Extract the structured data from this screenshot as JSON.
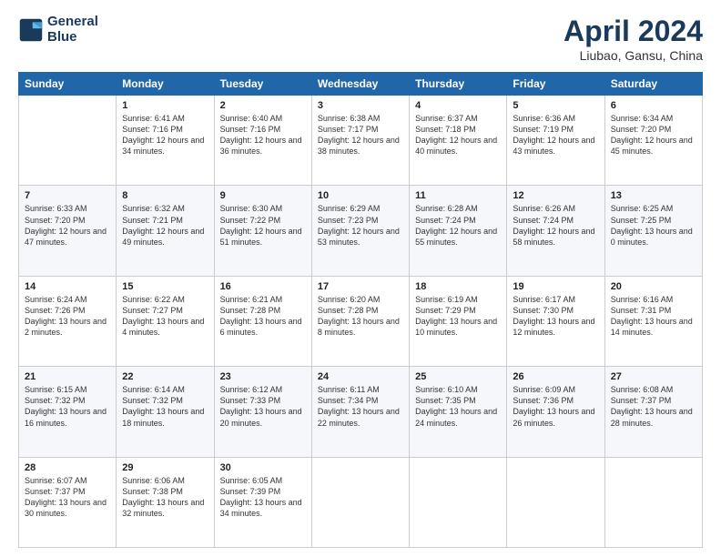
{
  "header": {
    "logo_line1": "General",
    "logo_line2": "Blue",
    "title": "April 2024",
    "subtitle": "Liubao, Gansu, China"
  },
  "weekdays": [
    "Sunday",
    "Monday",
    "Tuesday",
    "Wednesday",
    "Thursday",
    "Friday",
    "Saturday"
  ],
  "weeks": [
    [
      {
        "day": "",
        "sunrise": "",
        "sunset": "",
        "daylight": ""
      },
      {
        "day": "1",
        "sunrise": "Sunrise: 6:41 AM",
        "sunset": "Sunset: 7:16 PM",
        "daylight": "Daylight: 12 hours and 34 minutes."
      },
      {
        "day": "2",
        "sunrise": "Sunrise: 6:40 AM",
        "sunset": "Sunset: 7:16 PM",
        "daylight": "Daylight: 12 hours and 36 minutes."
      },
      {
        "day": "3",
        "sunrise": "Sunrise: 6:38 AM",
        "sunset": "Sunset: 7:17 PM",
        "daylight": "Daylight: 12 hours and 38 minutes."
      },
      {
        "day": "4",
        "sunrise": "Sunrise: 6:37 AM",
        "sunset": "Sunset: 7:18 PM",
        "daylight": "Daylight: 12 hours and 40 minutes."
      },
      {
        "day": "5",
        "sunrise": "Sunrise: 6:36 AM",
        "sunset": "Sunset: 7:19 PM",
        "daylight": "Daylight: 12 hours and 43 minutes."
      },
      {
        "day": "6",
        "sunrise": "Sunrise: 6:34 AM",
        "sunset": "Sunset: 7:20 PM",
        "daylight": "Daylight: 12 hours and 45 minutes."
      }
    ],
    [
      {
        "day": "7",
        "sunrise": "Sunrise: 6:33 AM",
        "sunset": "Sunset: 7:20 PM",
        "daylight": "Daylight: 12 hours and 47 minutes."
      },
      {
        "day": "8",
        "sunrise": "Sunrise: 6:32 AM",
        "sunset": "Sunset: 7:21 PM",
        "daylight": "Daylight: 12 hours and 49 minutes."
      },
      {
        "day": "9",
        "sunrise": "Sunrise: 6:30 AM",
        "sunset": "Sunset: 7:22 PM",
        "daylight": "Daylight: 12 hours and 51 minutes."
      },
      {
        "day": "10",
        "sunrise": "Sunrise: 6:29 AM",
        "sunset": "Sunset: 7:23 PM",
        "daylight": "Daylight: 12 hours and 53 minutes."
      },
      {
        "day": "11",
        "sunrise": "Sunrise: 6:28 AM",
        "sunset": "Sunset: 7:24 PM",
        "daylight": "Daylight: 12 hours and 55 minutes."
      },
      {
        "day": "12",
        "sunrise": "Sunrise: 6:26 AM",
        "sunset": "Sunset: 7:24 PM",
        "daylight": "Daylight: 12 hours and 58 minutes."
      },
      {
        "day": "13",
        "sunrise": "Sunrise: 6:25 AM",
        "sunset": "Sunset: 7:25 PM",
        "daylight": "Daylight: 13 hours and 0 minutes."
      }
    ],
    [
      {
        "day": "14",
        "sunrise": "Sunrise: 6:24 AM",
        "sunset": "Sunset: 7:26 PM",
        "daylight": "Daylight: 13 hours and 2 minutes."
      },
      {
        "day": "15",
        "sunrise": "Sunrise: 6:22 AM",
        "sunset": "Sunset: 7:27 PM",
        "daylight": "Daylight: 13 hours and 4 minutes."
      },
      {
        "day": "16",
        "sunrise": "Sunrise: 6:21 AM",
        "sunset": "Sunset: 7:28 PM",
        "daylight": "Daylight: 13 hours and 6 minutes."
      },
      {
        "day": "17",
        "sunrise": "Sunrise: 6:20 AM",
        "sunset": "Sunset: 7:28 PM",
        "daylight": "Daylight: 13 hours and 8 minutes."
      },
      {
        "day": "18",
        "sunrise": "Sunrise: 6:19 AM",
        "sunset": "Sunset: 7:29 PM",
        "daylight": "Daylight: 13 hours and 10 minutes."
      },
      {
        "day": "19",
        "sunrise": "Sunrise: 6:17 AM",
        "sunset": "Sunset: 7:30 PM",
        "daylight": "Daylight: 13 hours and 12 minutes."
      },
      {
        "day": "20",
        "sunrise": "Sunrise: 6:16 AM",
        "sunset": "Sunset: 7:31 PM",
        "daylight": "Daylight: 13 hours and 14 minutes."
      }
    ],
    [
      {
        "day": "21",
        "sunrise": "Sunrise: 6:15 AM",
        "sunset": "Sunset: 7:32 PM",
        "daylight": "Daylight: 13 hours and 16 minutes."
      },
      {
        "day": "22",
        "sunrise": "Sunrise: 6:14 AM",
        "sunset": "Sunset: 7:32 PM",
        "daylight": "Daylight: 13 hours and 18 minutes."
      },
      {
        "day": "23",
        "sunrise": "Sunrise: 6:12 AM",
        "sunset": "Sunset: 7:33 PM",
        "daylight": "Daylight: 13 hours and 20 minutes."
      },
      {
        "day": "24",
        "sunrise": "Sunrise: 6:11 AM",
        "sunset": "Sunset: 7:34 PM",
        "daylight": "Daylight: 13 hours and 22 minutes."
      },
      {
        "day": "25",
        "sunrise": "Sunrise: 6:10 AM",
        "sunset": "Sunset: 7:35 PM",
        "daylight": "Daylight: 13 hours and 24 minutes."
      },
      {
        "day": "26",
        "sunrise": "Sunrise: 6:09 AM",
        "sunset": "Sunset: 7:36 PM",
        "daylight": "Daylight: 13 hours and 26 minutes."
      },
      {
        "day": "27",
        "sunrise": "Sunrise: 6:08 AM",
        "sunset": "Sunset: 7:37 PM",
        "daylight": "Daylight: 13 hours and 28 minutes."
      }
    ],
    [
      {
        "day": "28",
        "sunrise": "Sunrise: 6:07 AM",
        "sunset": "Sunset: 7:37 PM",
        "daylight": "Daylight: 13 hours and 30 minutes."
      },
      {
        "day": "29",
        "sunrise": "Sunrise: 6:06 AM",
        "sunset": "Sunset: 7:38 PM",
        "daylight": "Daylight: 13 hours and 32 minutes."
      },
      {
        "day": "30",
        "sunrise": "Sunrise: 6:05 AM",
        "sunset": "Sunset: 7:39 PM",
        "daylight": "Daylight: 13 hours and 34 minutes."
      },
      {
        "day": "",
        "sunrise": "",
        "sunset": "",
        "daylight": ""
      },
      {
        "day": "",
        "sunrise": "",
        "sunset": "",
        "daylight": ""
      },
      {
        "day": "",
        "sunrise": "",
        "sunset": "",
        "daylight": ""
      },
      {
        "day": "",
        "sunrise": "",
        "sunset": "",
        "daylight": ""
      }
    ]
  ]
}
